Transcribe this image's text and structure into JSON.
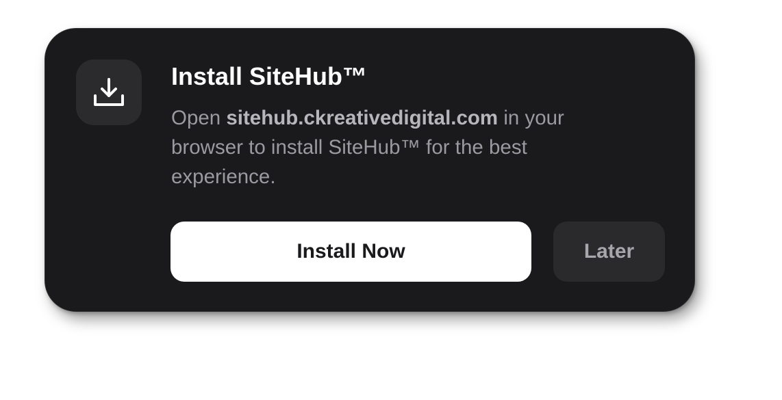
{
  "dialog": {
    "title": "Install SiteHub™",
    "description": {
      "prefix": "Open ",
      "url": "sitehub.ckreativedigital.com",
      "suffix": " in your browser to install SiteHub™ for the best experience."
    },
    "icon": "download-icon",
    "primary_button": "Install Now",
    "secondary_button": "Later"
  },
  "colors": {
    "card_background": "#1a1a1c",
    "icon_tile": "#2b2b2e",
    "primary_button_bg": "#ffffff",
    "secondary_button_bg": "#2a2a2d",
    "title_text": "#ffffff",
    "body_text": "#9a9aa0"
  }
}
